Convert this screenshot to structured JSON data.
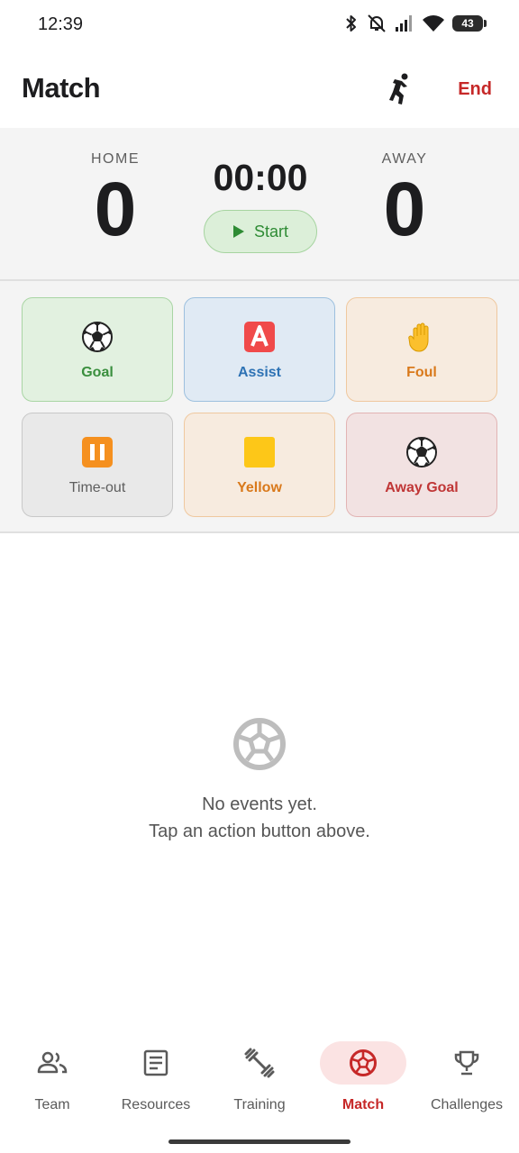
{
  "status_bar": {
    "time": "12:39",
    "battery": "43",
    "icons": [
      "bluetooth-icon",
      "bell-off-icon",
      "signal-icon",
      "wifi-icon",
      "battery-icon"
    ]
  },
  "app_bar": {
    "title": "Match",
    "player_icon": "player-running-icon",
    "end_label": "End",
    "end_color": "#c62828"
  },
  "scoreboard": {
    "home_label": "HOME",
    "home_score": "0",
    "away_label": "AWAY",
    "away_score": "0",
    "timer": "00:00",
    "start_label": "Start"
  },
  "actions": [
    {
      "label": "Goal",
      "icon": "soccer-ball-icon",
      "color": "#3a8f3e"
    },
    {
      "label": "Assist",
      "icon": "letter-a-icon",
      "color": "#2d72b4"
    },
    {
      "label": "Foul",
      "icon": "raised-hand-icon",
      "color": "#d9791b"
    },
    {
      "label": "Time-out",
      "icon": "pause-icon",
      "color": "#5e5e5e"
    },
    {
      "label": "Yellow",
      "icon": "yellow-square-icon",
      "color": "#d9791b"
    },
    {
      "label": "Away Goal",
      "icon": "soccer-ball-icon",
      "color": "#c03636"
    }
  ],
  "empty_state": {
    "icon": "soccer-ball-outline-icon",
    "line1": "No events yet.",
    "line2": "Tap an action button above."
  },
  "bottom_nav": {
    "items": [
      {
        "label": "Team",
        "icon": "people-icon"
      },
      {
        "label": "Resources",
        "icon": "article-icon"
      },
      {
        "label": "Training",
        "icon": "dumbbell-icon"
      },
      {
        "label": "Match",
        "icon": "soccer-ball-icon",
        "active": true
      },
      {
        "label": "Challenges",
        "icon": "trophy-icon"
      }
    ],
    "active_color": "#c62828"
  }
}
